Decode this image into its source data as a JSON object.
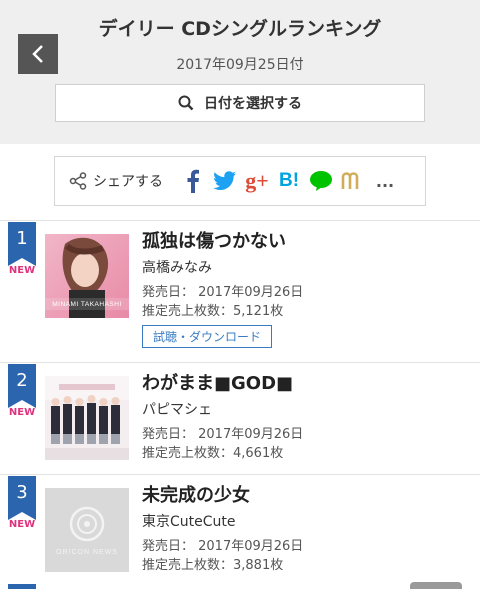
{
  "header": {
    "title": "デイリー CDシングルランキング",
    "date": "2017年09月25日付",
    "date_button_label": "日付を選択する"
  },
  "share": {
    "label": "シェアする",
    "buttons": [
      "facebook",
      "twitter",
      "google-plus",
      "hatena-bookmark",
      "line",
      "mixi",
      "more"
    ],
    "hatena_text": "B!",
    "google_text": "g+",
    "more_text": "..."
  },
  "ranking": [
    {
      "rank": "1",
      "new": "NEW",
      "title": "孤独は傷つかない",
      "artist": "高橋みなみ",
      "release": "発売日： 2017年09月26日",
      "sales": "推定売上枚数：5,121枚",
      "listen": "試聴・ダウンロード",
      "jacket_text": "MINAMI TAKAHASHI"
    },
    {
      "rank": "2",
      "new": "NEW",
      "title": "わがまま■GOD■",
      "artist": "パピマシェ",
      "release": "発売日： 2017年09月26日",
      "sales": "推定売上枚数：4,661枚"
    },
    {
      "rank": "3",
      "new": "NEW",
      "title": "未完成の少女",
      "artist": "東京CuteCute",
      "release": "発売日： 2017年09月26日",
      "sales": "推定売上枚数：3,881枚",
      "jacket_text": "ORICON NEWS"
    }
  ],
  "colors": {
    "badge": "#2b65ad",
    "new": "#e0337f",
    "link": "#3a7cc3"
  }
}
